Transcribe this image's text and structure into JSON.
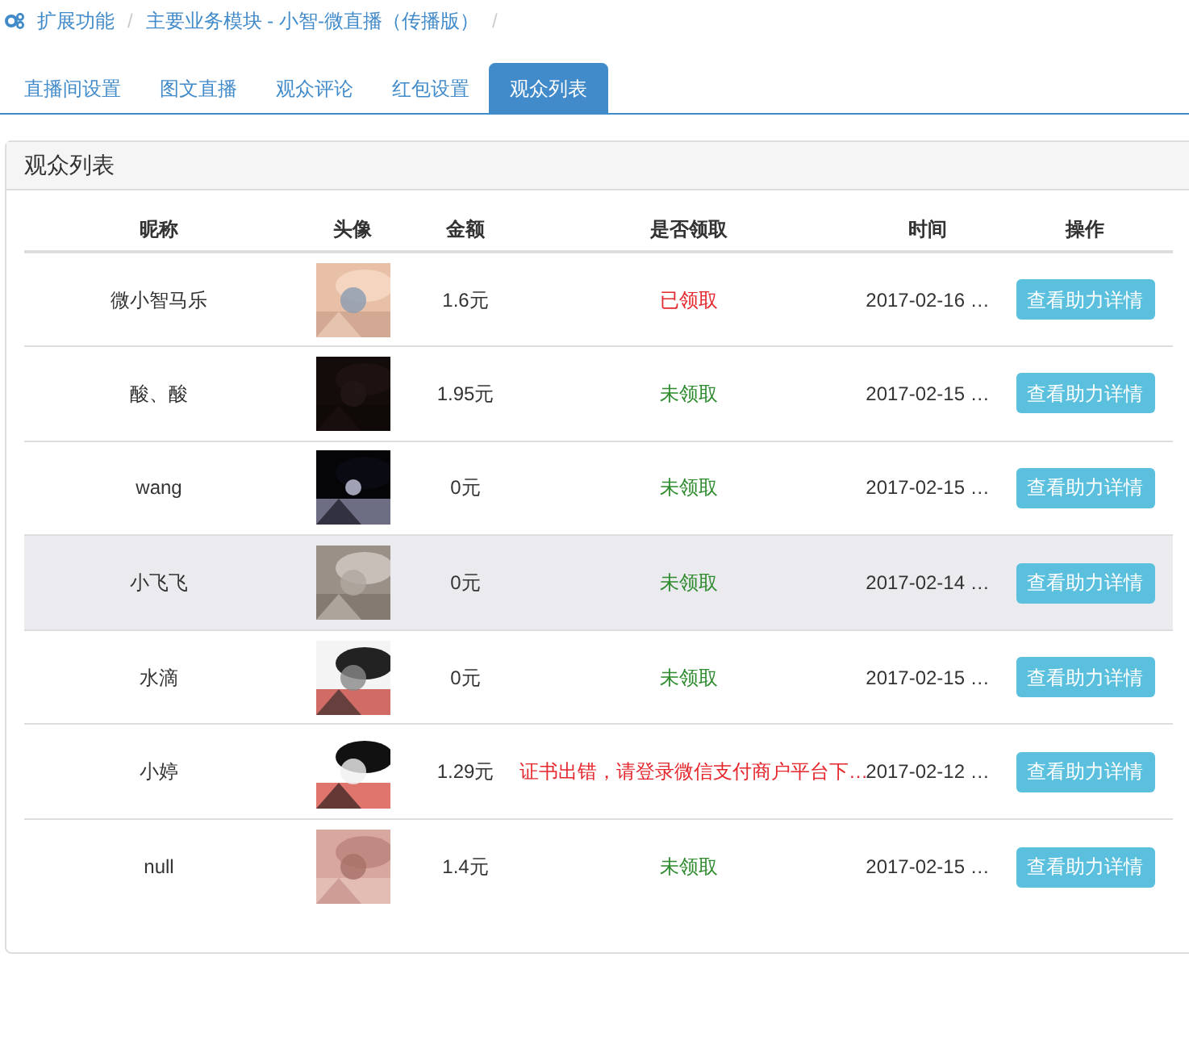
{
  "breadcrumb": [
    {
      "label": "扩展功能",
      "separator": "/"
    },
    {
      "label": "主要业务模块 - 小智-微直播（传播版）",
      "separator": "/"
    }
  ],
  "tabs": [
    {
      "label": "直播间设置",
      "selected": false
    },
    {
      "label": "图文直播",
      "selected": false
    },
    {
      "label": "观众评论",
      "selected": false
    },
    {
      "label": "红包设置",
      "selected": false
    },
    {
      "label": "观众列表",
      "selected": true
    }
  ],
  "panel": {
    "title": "观众列表"
  },
  "table": {
    "columns": [
      "昵称",
      "头像",
      "金额",
      "是否领取",
      "时间",
      "操作"
    ],
    "rows": [
      {
        "nickname": "微小智马乐",
        "amount": "1.6元",
        "status": "已领取",
        "color": "#e4262d",
        "time": "2017-02-16 …",
        "action": "查看助力详情",
        "selected": false
      },
      {
        "nickname": "酸、酸",
        "amount": "1.95元",
        "status": "未领取",
        "color": "#2e8b2e",
        "time": "2017-02-15 …",
        "action": "查看助力详情",
        "selected": false
      },
      {
        "nickname": "wang",
        "amount": "0元",
        "status": "未领取",
        "color": "#2e8b2e",
        "time": "2017-02-15 …",
        "action": "查看助力详情",
        "selected": false
      },
      {
        "nickname": "小飞飞",
        "amount": "0元",
        "status": "未领取",
        "color": "#2e8b2e",
        "time": "2017-02-14 …",
        "action": "查看助力详情",
        "selected": true
      },
      {
        "nickname": "水滴",
        "amount": "0元",
        "status": "未领取",
        "color": "#2e8b2e",
        "time": "2017-02-15 …",
        "action": "查看助力详情",
        "selected": false
      },
      {
        "nickname": "小婷",
        "amount": "1.29元",
        "status": "证书出错，请登录微信支付商户平台下…",
        "color": "#e4262d",
        "time": "2017-02-12 …",
        "action": "查看助力详情",
        "selected": false
      },
      {
        "nickname": "null",
        "amount": "1.4元",
        "status": "未领取",
        "color": "#2e8b2e",
        "time": "2017-02-15 …",
        "action": "查看助力详情",
        "selected": false
      }
    ]
  }
}
